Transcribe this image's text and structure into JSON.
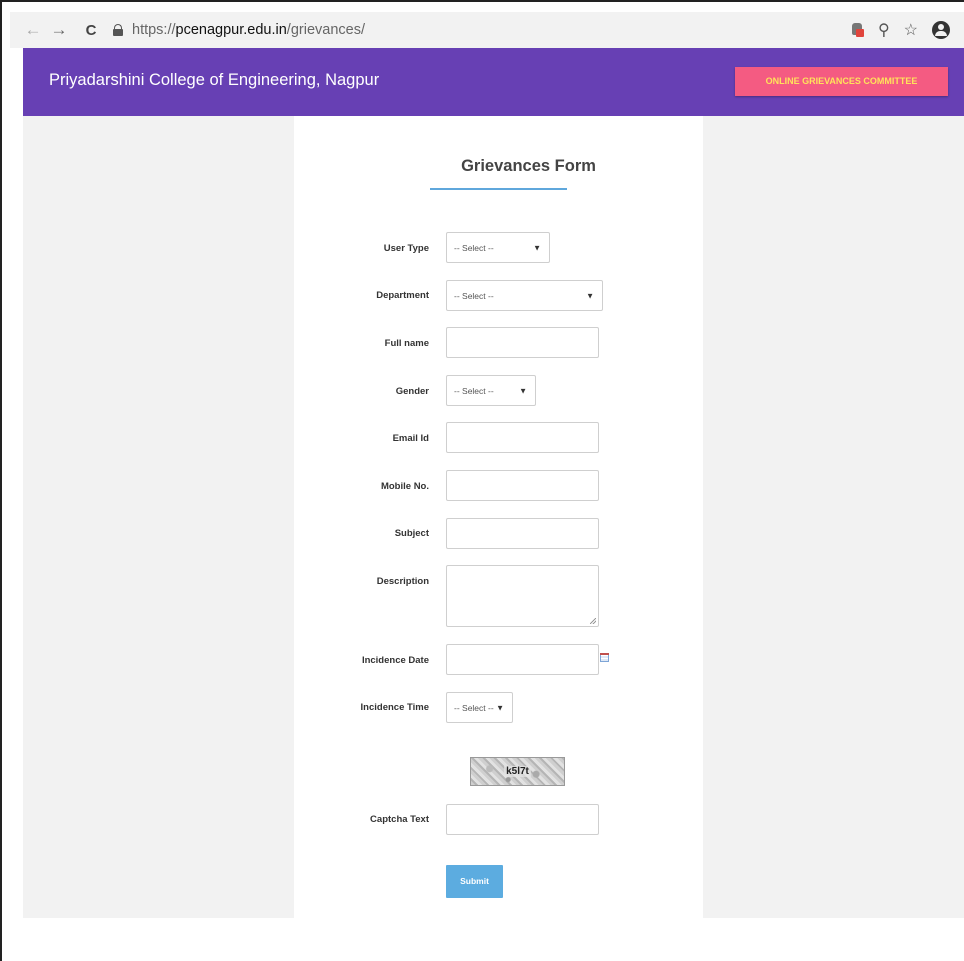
{
  "browser": {
    "url_prefix": "https://",
    "url_host": "pcenagpur.edu.in",
    "url_path": "/grievances/"
  },
  "header": {
    "site_title": "Priyadarshini College of Engineering, Nagpur",
    "committee_button": "ONLINE GRIEVANCES COMMITTEE",
    "background_color": "#6740b4",
    "button_color": "#f45b82"
  },
  "form": {
    "title": "Grievances Form",
    "fields": {
      "user_type": {
        "label": "User Type",
        "value": "-- Select --"
      },
      "department": {
        "label": "Department",
        "value": "-- Select --"
      },
      "full_name": {
        "label": "Full name",
        "value": ""
      },
      "gender": {
        "label": "Gender",
        "value": "-- Select --"
      },
      "email": {
        "label": "Email Id",
        "value": ""
      },
      "mobile": {
        "label": "Mobile No.",
        "value": ""
      },
      "subject": {
        "label": "Subject",
        "value": ""
      },
      "description": {
        "label": "Description",
        "value": ""
      },
      "incidence_date": {
        "label": "Incidence Date",
        "value": ""
      },
      "incidence_time": {
        "label": "Incidence Time",
        "value": "-- Select --"
      },
      "captcha_text": {
        "label": "Captcha Text",
        "value": ""
      }
    },
    "captcha_image_text": "k5l7t",
    "submit_label": "Submit",
    "submit_color": "#5cace0"
  }
}
